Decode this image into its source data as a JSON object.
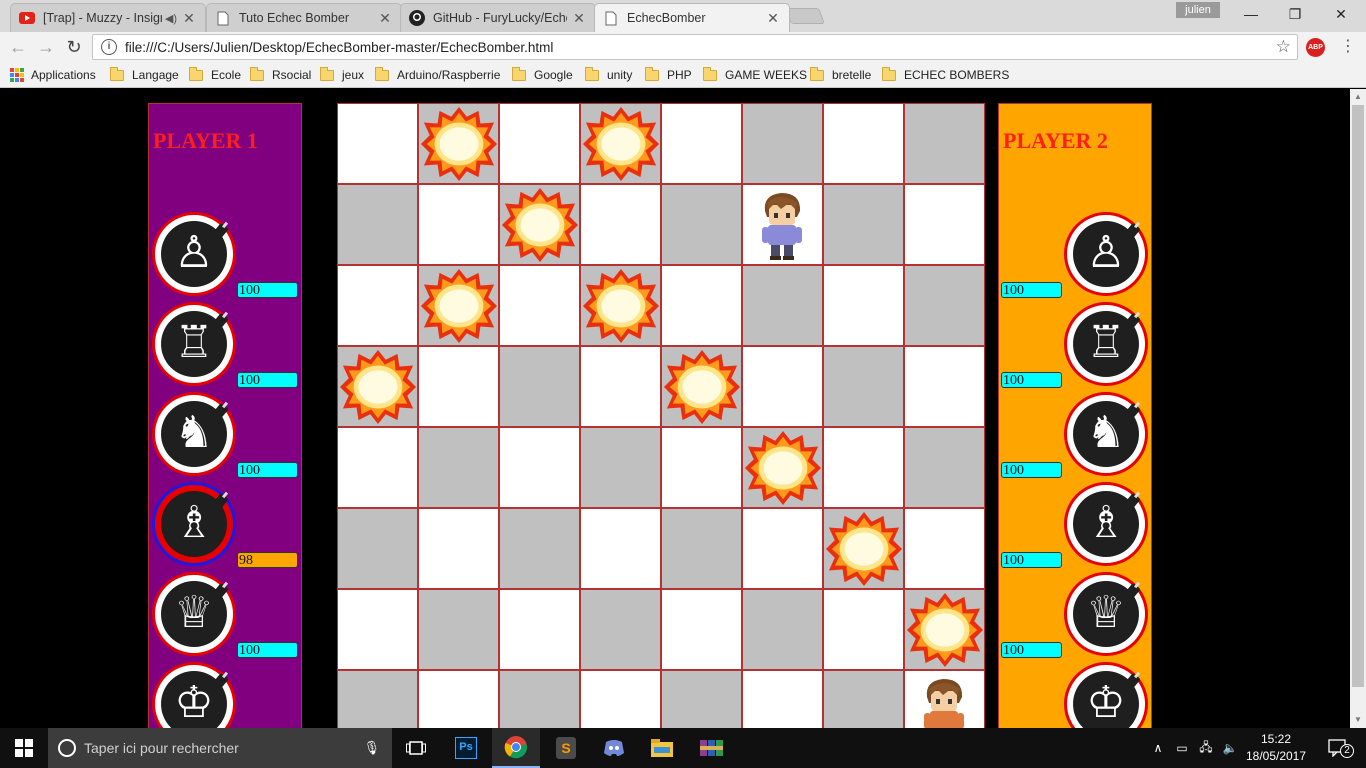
{
  "browser": {
    "tabs": [
      {
        "title": "[Trap] - Muzzy - Insigr",
        "icon": "youtube-icon",
        "audio": true
      },
      {
        "title": "Tuto Echec Bomber",
        "icon": "page-icon",
        "audio": false
      },
      {
        "title": "GitHub - FuryLucky/Eche",
        "icon": "github-icon",
        "audio": false
      },
      {
        "title": "EchecBomber",
        "icon": "page-icon",
        "audio": false,
        "active": true
      }
    ],
    "profile_name": "julien",
    "url": "file:///C:/Users/Julien/Desktop/EchecBomber-master/EchecBomber.html",
    "extension": "ABP",
    "bookmarks": [
      "Applications",
      "Langage",
      "Ecole",
      "Rsocial",
      "jeux",
      "Arduino/Raspberrie",
      "Google",
      "unity",
      "PHP",
      "GAME WEEKS",
      "bretelle",
      "ECHEC BOMBERS"
    ]
  },
  "game": {
    "player1": {
      "title": "PLAYER 1",
      "color": "#800080",
      "pieces": [
        {
          "piece": "pawn",
          "glyph": "♙",
          "hp": "100",
          "hp_color": "#00ffff",
          "selected": false
        },
        {
          "piece": "rook",
          "glyph": "♖",
          "hp": "100",
          "hp_color": "#00ffff",
          "selected": false
        },
        {
          "piece": "knight",
          "glyph": "♞",
          "hp": "100",
          "hp_color": "#00ffff",
          "selected": false
        },
        {
          "piece": "bishop",
          "glyph": "♗",
          "hp": "98",
          "hp_color": "#ffa500",
          "selected": true
        },
        {
          "piece": "queen",
          "glyph": "♕",
          "hp": "100",
          "hp_color": "#00ffff",
          "selected": false
        },
        {
          "piece": "king",
          "glyph": "♔",
          "hp": "",
          "hp_color": "#00ffff",
          "selected": false
        }
      ]
    },
    "player2": {
      "title": "PLAYER 2",
      "color": "#ffa500",
      "pieces": [
        {
          "piece": "pawn",
          "glyph": "♙",
          "hp": "100",
          "hp_color": "#00ffff",
          "selected": false
        },
        {
          "piece": "rook",
          "glyph": "♖",
          "hp": "100",
          "hp_color": "#00ffff",
          "selected": false
        },
        {
          "piece": "knight",
          "glyph": "♞",
          "hp": "100",
          "hp_color": "#00ffff",
          "selected": false
        },
        {
          "piece": "bishop",
          "glyph": "♗",
          "hp": "100",
          "hp_color": "#00ffff",
          "selected": false
        },
        {
          "piece": "queen",
          "glyph": "♕",
          "hp": "100",
          "hp_color": "#00ffff",
          "selected": false
        },
        {
          "piece": "king",
          "glyph": "♔",
          "hp": "",
          "hp_color": "#00ffff",
          "selected": false
        }
      ]
    },
    "board": {
      "rows": 8,
      "cols": 8,
      "explosions": [
        [
          0,
          1
        ],
        [
          0,
          3
        ],
        [
          1,
          2
        ],
        [
          2,
          1
        ],
        [
          2,
          3
        ],
        [
          3,
          0
        ],
        [
          3,
          4
        ],
        [
          4,
          5
        ],
        [
          5,
          6
        ],
        [
          6,
          7
        ]
      ],
      "characters": [
        {
          "name": "player1-character",
          "row": 1,
          "col": 5,
          "shirt": "#8a8ad8"
        },
        {
          "name": "player2-character",
          "row": 7,
          "col": 7,
          "shirt": "#e07a3c"
        }
      ]
    }
  },
  "taskbar": {
    "search_placeholder": "Taper ici pour rechercher",
    "time": "15:22",
    "date": "18/05/2017",
    "notifications": "2",
    "apps": [
      "task-view-icon",
      "photoshop-icon",
      "chrome-icon",
      "sublime-icon",
      "discord-icon",
      "file-explorer-icon",
      "winrar-icon"
    ]
  }
}
